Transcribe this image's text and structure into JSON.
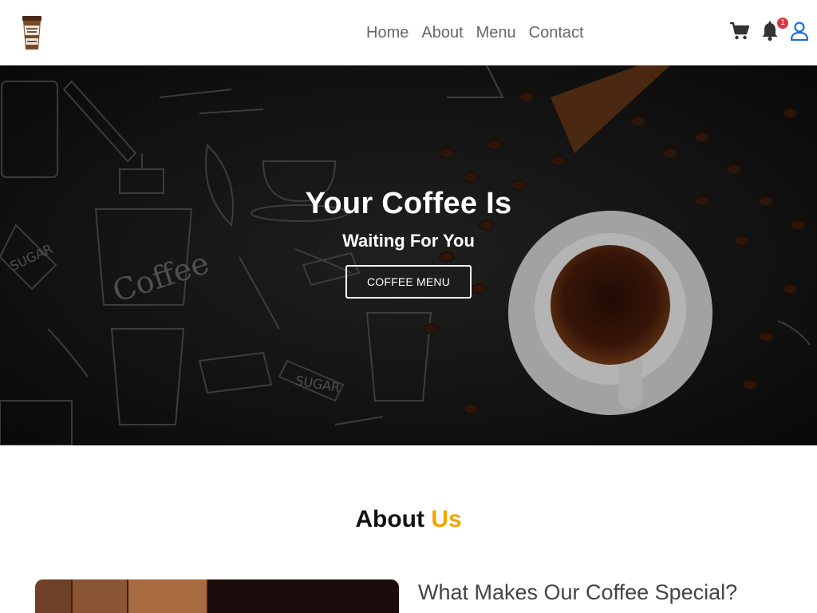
{
  "nav": {
    "logo_icon": "coffee-cup-logo",
    "links": [
      "Home",
      "About",
      "Menu",
      "Contact"
    ],
    "cart_icon": "cart-icon",
    "bell_icon": "bell-icon",
    "notification_count": "1",
    "user_icon": "user-icon"
  },
  "hero": {
    "title": "Your Coffee Is",
    "subtitle": "Waiting For You",
    "button_label": "COFFEE MENU"
  },
  "about": {
    "title_main": "About",
    "title_accent": "Us",
    "heading": "What Makes Our Coffee Special?"
  },
  "colors": {
    "accent": "#f0a500",
    "badge": "#dc3545",
    "user_icon": "#1a6fd6",
    "hero_bg": "#151515"
  }
}
